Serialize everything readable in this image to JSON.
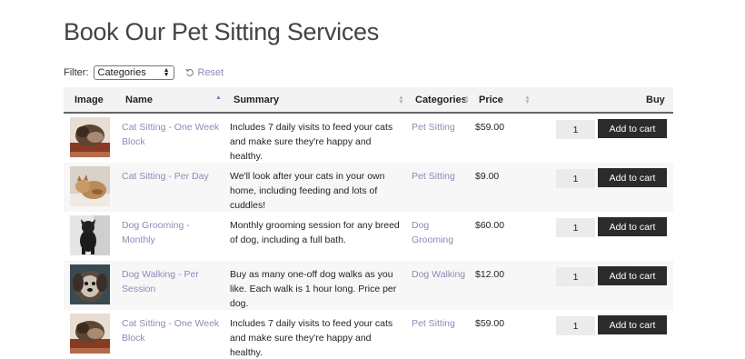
{
  "page": {
    "title": "Book Our Pet Sitting Services"
  },
  "filter": {
    "label": "Filter:",
    "selected": "Categories",
    "reset_label": "Reset"
  },
  "table": {
    "headers": {
      "image": "Image",
      "name": "Name",
      "summary": "Summary",
      "categories": "Categories",
      "price": "Price",
      "buy": "Buy"
    },
    "add_to_cart_label": "Add to cart",
    "rows": [
      {
        "name": "Cat Sitting - One Week Block",
        "summary": "Includes 7 daily visits to feed your cats and make sure they're happy and healthy.",
        "category": "Pet Sitting",
        "price": "$59.00",
        "qty": "1",
        "image": "cat-photo"
      },
      {
        "name": "Cat Sitting - Per Day",
        "summary": "We'll look after your cats in your own home, including feeding and lots of cuddles!",
        "category": "Pet Sitting",
        "price": "$9.00",
        "qty": "1",
        "image": "kitten-photo"
      },
      {
        "name": "Dog Grooming - Monthly",
        "summary": "Monthly grooming session for any breed of dog, including a full bath.",
        "category": "Dog Grooming",
        "price": "$60.00",
        "qty": "1",
        "image": "black-dog-photo"
      },
      {
        "name": "Dog Walking - Per Session",
        "summary": "Buy as many one-off dog walks as you like. Each walk is 1 hour long. Price per dog.",
        "category": "Dog Walking",
        "price": "$12.00",
        "qty": "1",
        "image": "fluffy-dog-photo"
      },
      {
        "name": "Cat Sitting - One Week Block",
        "summary": "Includes 7 daily visits to feed your cats and make sure they're happy and healthy.",
        "category": "Pet Sitting",
        "price": "$59.00",
        "qty": "1",
        "image": "cat-photo"
      }
    ]
  },
  "colors": {
    "link": "#8a8cb8",
    "button_bg": "#2b2b2b",
    "header_bg": "#f3f3f3",
    "row_alt_bg": "#f7f7f7"
  }
}
